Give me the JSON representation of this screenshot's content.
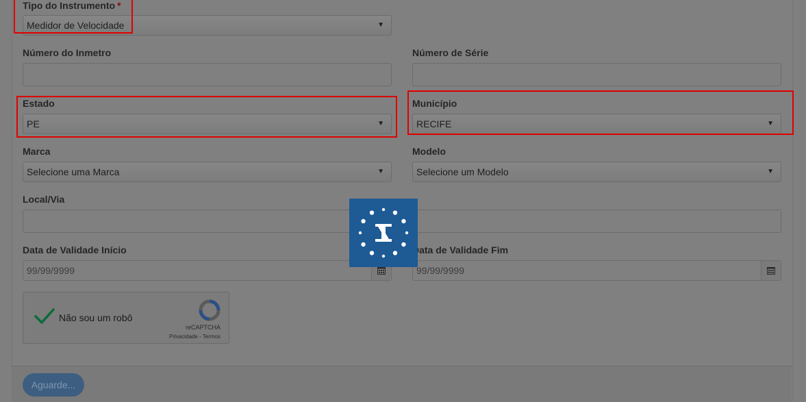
{
  "form": {
    "tipo": {
      "label": "Tipo do Instrumento",
      "required_mark": "*",
      "value": "Medidor de Velocidade"
    },
    "inmetro": {
      "label": "Número do Inmetro",
      "value": ""
    },
    "serie": {
      "label": "Número de Série",
      "value": ""
    },
    "estado": {
      "label": "Estado",
      "value": "PE"
    },
    "municipio": {
      "label": "Município",
      "value": "RECIFE"
    },
    "marca": {
      "label": "Marca",
      "value": "Selecione uma Marca"
    },
    "modelo": {
      "label": "Modelo",
      "value": "Selecione um Modelo"
    },
    "local": {
      "label": "Local/Via",
      "value": ""
    },
    "validade_inicio": {
      "label": "Data de Validade Início",
      "placeholder": "99/99/9999"
    },
    "validade_fim": {
      "label": "Data de Validade Fim",
      "placeholder": "99/99/9999"
    }
  },
  "recaptcha": {
    "label": "Não sou um robô",
    "brand": "reCAPTCHA",
    "links": "Privacidade - Termos",
    "checked": true
  },
  "submit": {
    "label": "Aguarde..."
  },
  "colors": {
    "highlight": "#e00000",
    "loader_bg": "#1e5a94",
    "check": "#0b6b3a"
  },
  "loader": {
    "icon": "inmetro-logo-icon"
  }
}
